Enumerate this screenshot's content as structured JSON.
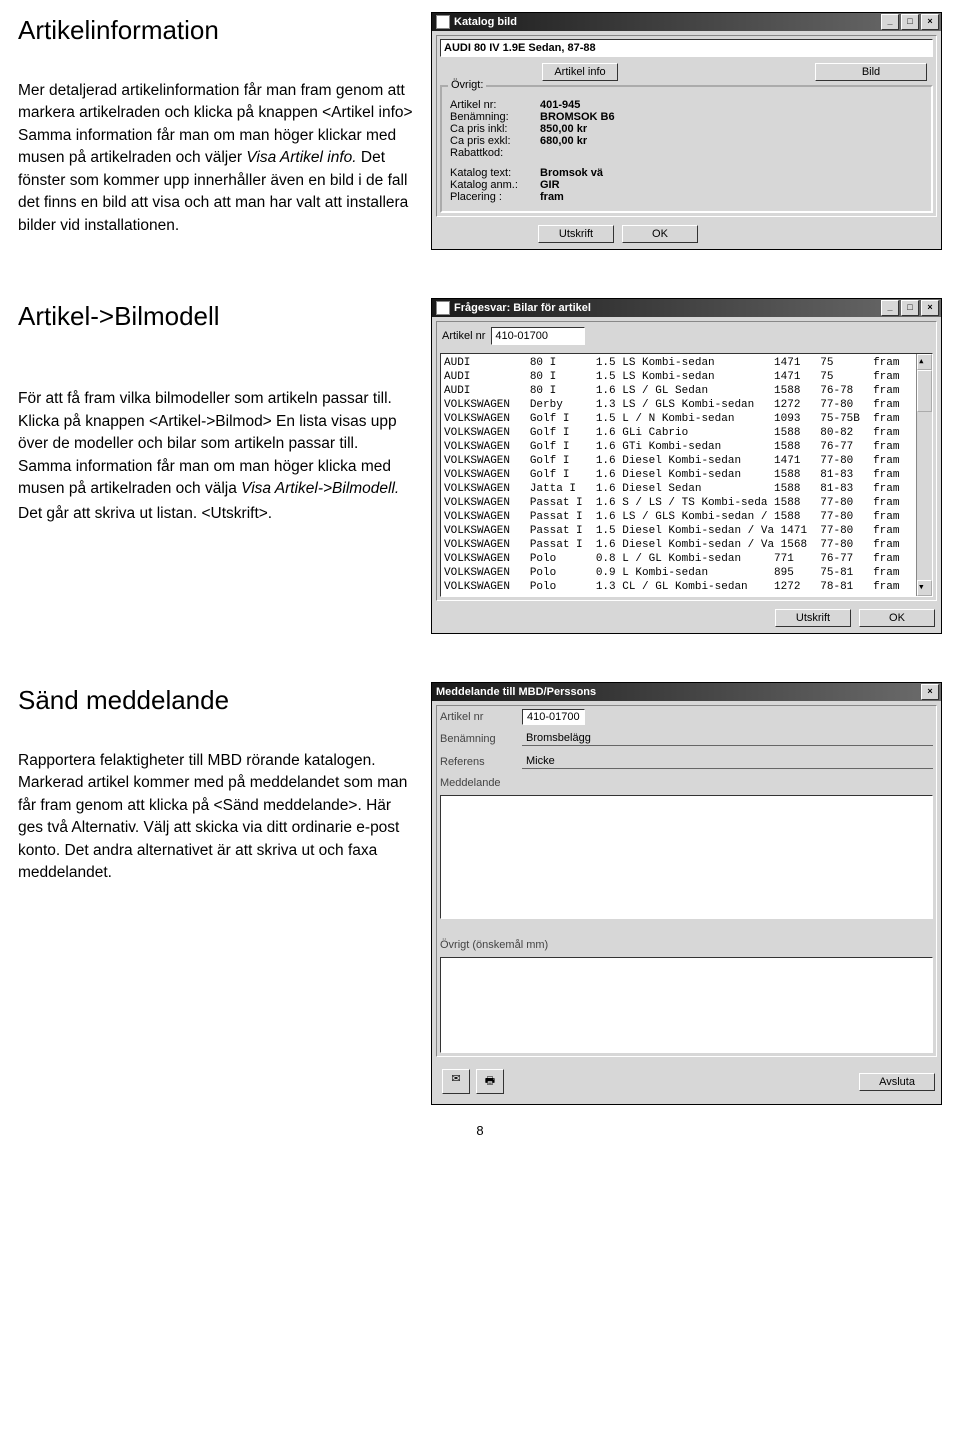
{
  "page_number": "8",
  "sections": {
    "s1": {
      "heading": "Artikelinformation",
      "para": "Mer detaljerad artikelinformation får man fram genom att markera artikelraden och klicka på knappen <Artikel info> Samma information får man om man höger klickar med musen på artikelraden och väljer ",
      "para_italic": "Visa Artikel info.",
      "para2": " Det fönster som kommer upp innerhåller även en bild i de fall det finns en bild att visa och att man har valt att installera bilder vid installationen."
    },
    "s2": {
      "heading": "Artikel->Bilmodell",
      "para": "För att få fram vilka bilmodeller som artikeln passar till. Klicka på knappen <Artikel->Bilmod> En lista visas upp över de modeller och bilar som artikeln passar till.\nSamma information får man om man höger klicka med musen på artikelraden och välja ",
      "para_italic": "Visa Artikel->Bilmodell.",
      "para2": "Det går att skriva ut listan. <Utskrift>."
    },
    "s3": {
      "heading": "Sänd meddelande",
      "para": "Rapportera felaktigheter till MBD rörande katalogen.\nMarkerad artikel kommer med på meddelandet som man får fram genom att klicka på <Sänd meddelande>. Här ges två Alternativ. Välj att skicka via ditt ordinarie e-post konto. Det andra alternativet är att skriva ut och faxa meddelandet."
    }
  },
  "win1": {
    "title": "Katalog bild",
    "heading": "AUDI 80 IV 1.9E Sedan, 87-88",
    "btn_info": "Artikel info",
    "btn_bild": "Bild",
    "group": "Övrigt:",
    "rows": {
      "artikel_nr": {
        "k": "Artikel nr:",
        "v": "401-945"
      },
      "benamning": {
        "k": "Benämning:",
        "v": "BROMSOK B6"
      },
      "ca_inkl": {
        "k": "Ca pris inkl:",
        "v": "850,00 kr"
      },
      "ca_exkl": {
        "k": "Ca pris exkl:",
        "v": "680,00 kr"
      },
      "rabatt": {
        "k": "Rabattkod:",
        "v": ""
      },
      "katalog_text": {
        "k": "Katalog text:",
        "v": "Bromsok vä"
      },
      "katalog_anm": {
        "k": "Katalog anm.:",
        "v": "GIR"
      },
      "placering": {
        "k": "Placering  :",
        "v": "fram"
      }
    },
    "btn_utskrift": "Utskrift",
    "btn_ok": "OK"
  },
  "win2": {
    "title": "Frågesvar: Bilar för artikel",
    "lbl_artikel": "Artikel nr",
    "artikel_value": "410-01700",
    "rows": [
      "AUDI         80 I      1.5 LS Kombi-sedan         1471   75      fram",
      "AUDI         80 I      1.5 LS Kombi-sedan         1471   75      fram",
      "AUDI         80 I      1.6 LS / GL Sedan          1588   76-78   fram",
      "VOLKSWAGEN   Derby     1.3 LS / GLS Kombi-sedan   1272   77-80   fram",
      "VOLKSWAGEN   Golf I    1.5 L / N Kombi-sedan      1093   75-75B  fram",
      "VOLKSWAGEN   Golf I    1.6 GLi Cabrio             1588   80-82   fram",
      "VOLKSWAGEN   Golf I    1.6 GTi Kombi-sedan        1588   76-77   fram",
      "VOLKSWAGEN   Golf I    1.6 Diesel Kombi-sedan     1471   77-80   fram",
      "VOLKSWAGEN   Golf I    1.6 Diesel Kombi-sedan     1588   81-83   fram",
      "VOLKSWAGEN   Jatta I   1.6 Diesel Sedan           1588   81-83   fram",
      "VOLKSWAGEN   Passat I  1.6 S / LS / TS Kombi-seda 1588   77-80   fram",
      "VOLKSWAGEN   Passat I  1.6 LS / GLS Kombi-sedan / 1588   77-80   fram",
      "VOLKSWAGEN   Passat I  1.5 Diesel Kombi-sedan / Va 1471  77-80   fram",
      "VOLKSWAGEN   Passat I  1.6 Diesel Kombi-sedan / Va 1568  77-80   fram",
      "VOLKSWAGEN   Polo      0.8 L / GL Kombi-sedan     771    76-77   fram",
      "VOLKSWAGEN   Polo      0.9 L Kombi-sedan          895    75-81   fram",
      "VOLKSWAGEN   Polo      1.3 CL / GL Kombi-sedan    1272   78-81   fram"
    ],
    "btn_utskrift": "Utskrift",
    "btn_ok": "OK"
  },
  "win3": {
    "title": "Meddelande till MBD/Perssons",
    "rows": {
      "artikel": {
        "k": "Artikel nr",
        "v": "410-01700"
      },
      "benamning": {
        "k": "Benämning",
        "v": "Bromsbelägg"
      },
      "referens": {
        "k": "Referens",
        "v": "Micke"
      },
      "meddelande": {
        "k": "Meddelande"
      },
      "ovrigt": {
        "k": "Övrigt (önskemål mm)"
      }
    },
    "btn_avsluta": "Avsluta"
  }
}
